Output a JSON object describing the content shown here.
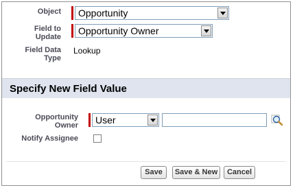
{
  "fields": {
    "object_label": "Object",
    "object_value": "Opportunity",
    "field_to_update_label_line1": "Field to",
    "field_to_update_label_line2": "Update",
    "field_to_update_value": "Opportunity Owner",
    "field_data_type_label_line1": "Field Data",
    "field_data_type_label_line2": "Type",
    "field_data_type_value": "Lookup"
  },
  "section": {
    "title": "Specify New Field Value"
  },
  "new_value": {
    "owner_label_line1": "Opportunity",
    "owner_label_line2": "Owner",
    "owner_type_value": "User",
    "owner_lookup_value": "",
    "notify_label": "Notify Assignee",
    "notify_checked": false
  },
  "buttons": {
    "save": "Save",
    "save_new": "Save & New",
    "cancel": "Cancel"
  },
  "icons": {
    "lookup": "lookup-magnifier-icon",
    "dropdown": "chevron-down-icon"
  },
  "colors": {
    "required_marker": "#c00000",
    "section_bar": "#dfe4ee",
    "label_text": "#4a4a56"
  }
}
